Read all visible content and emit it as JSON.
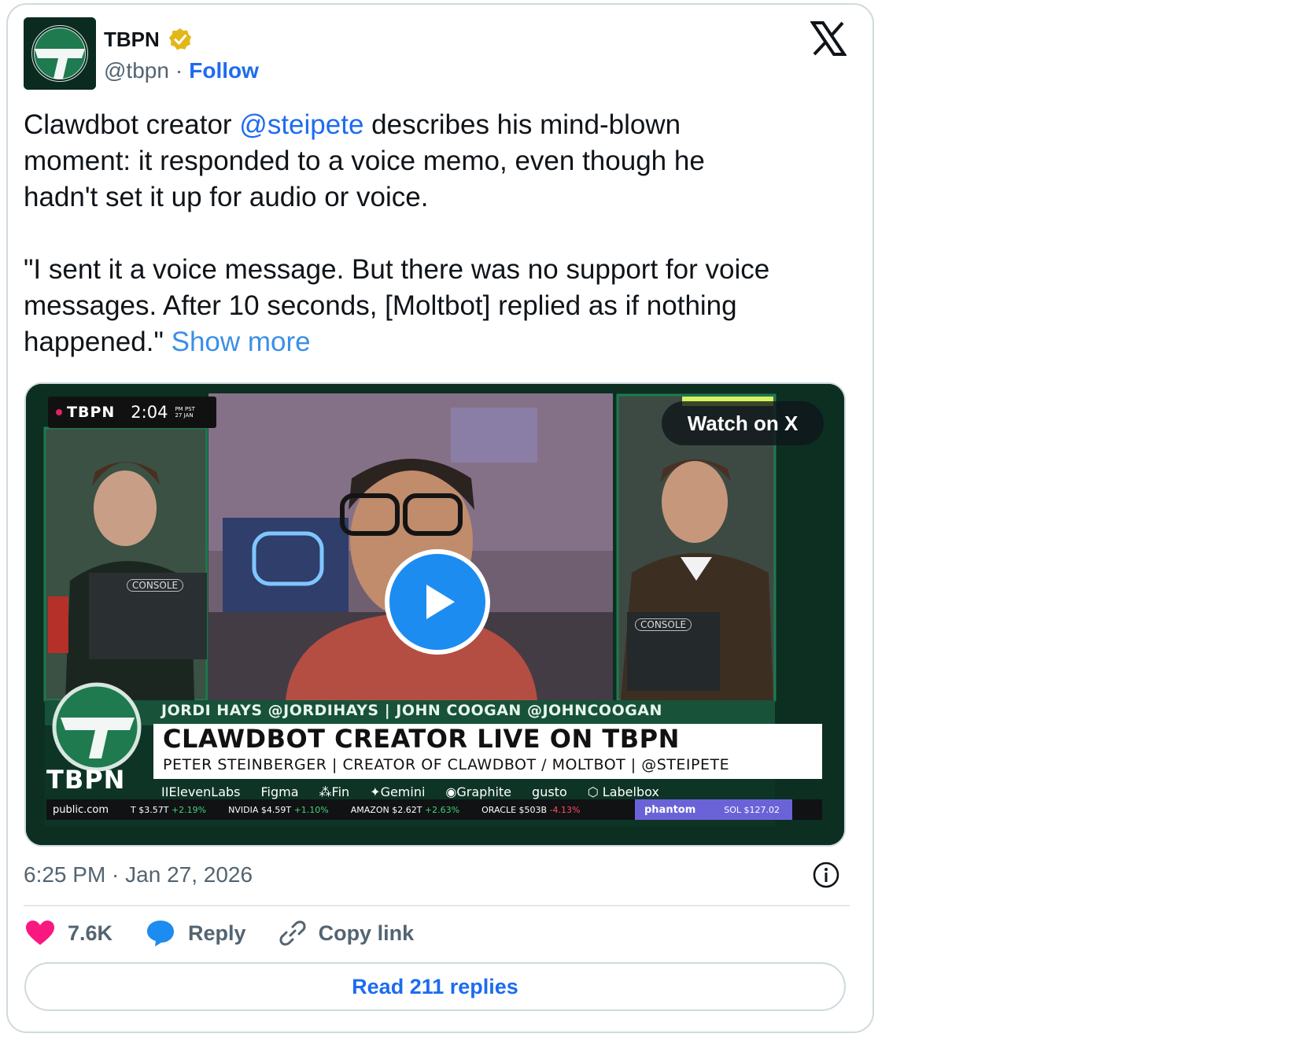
{
  "author": {
    "name": "TBPN",
    "handle": "@tbpn",
    "separator": "·",
    "follow_label": "Follow"
  },
  "tweet": {
    "text_before_mention": "Clawdbot creator ",
    "mention": "@steipete",
    "text_after_mention": " describes his mind-blown\nmoment: it responded to a voice memo, even though he\nhadn't set it up for audio or voice.\n\n\"I sent it a voice message. But there was no support for voice\nmessages. After 10 seconds, [Moltbot] replied as if nothing\nhappened.\" ",
    "show_more": "Show more"
  },
  "video": {
    "watch_label": "Watch on X",
    "live_brand": "TBPN",
    "live_time": "2:04",
    "live_time_sub": "PM PST",
    "live_date_sub": "27 JAN",
    "laptop_brand": "CONSOLE",
    "lower_third": {
      "names": "JORDI HAYS @JORDIHAYS | JOHN COOGAN @JOHNCOOGAN",
      "headline": "CLAWDBOT CREATOR LIVE ON TBPN",
      "subline": "PETER STEINBERGER | CREATOR OF CLAWDBOT / MOLTBOT | @STEIPETE",
      "brand": "TBPN",
      "sponsors": [
        "IIElevenLabs",
        "Figma",
        "⁂Fin",
        "✦Gemini",
        "◉Graphite",
        "gusto",
        "⬡ Labelbox"
      ],
      "ticker_left": "public.com",
      "ticker": [
        {
          "label": "T $3.57T",
          "change": "+2.19%",
          "dir": "up"
        },
        {
          "label": "NVIDIA $4.59T",
          "change": "+1.10%",
          "dir": "up"
        },
        {
          "label": "AMAZON $2.62T",
          "change": "+2.63%",
          "dir": "up"
        },
        {
          "label": "ORACLE $503B",
          "change": "-4.13%",
          "dir": "down"
        }
      ],
      "phantom_label": "phantom",
      "sol_label": "SOL $127.02"
    }
  },
  "meta": {
    "timestamp": "6:25 PM · Jan 27, 2026"
  },
  "actions": {
    "like_count": "7.6K",
    "reply_label": "Reply",
    "copy_label": "Copy link",
    "read_replies": "Read 211 replies"
  },
  "colors": {
    "link": "#1d6cf0",
    "like": "#f91880",
    "reply": "#1d8cf0",
    "verified": "#e2b719",
    "tbpn_green": "#1f7a4f"
  }
}
